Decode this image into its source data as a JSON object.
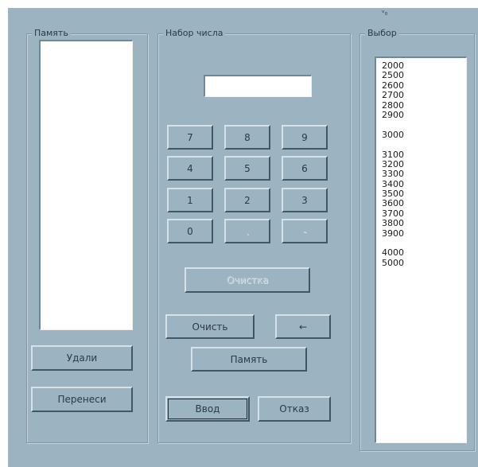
{
  "groups": {
    "memory_title": "Память",
    "input_title": "Набор числа",
    "choice_title": "Выбор"
  },
  "memory": {
    "items": [],
    "delete_label": "Удали",
    "transfer_label": "Перенеси"
  },
  "input": {
    "display_value": "",
    "keypad": [
      "7",
      "8",
      "9",
      "4",
      "5",
      "6",
      "1",
      "2",
      "3",
      "0",
      ".",
      "-"
    ],
    "backspace_label": "Очистка",
    "clear_label": "Очисть",
    "back_arrow": "←",
    "memory_label": "Память",
    "enter_label": "Ввод",
    "cancel_label": "Отказ"
  },
  "choice": {
    "values": [
      "2000",
      "2500",
      "2600",
      "2700",
      "2800",
      "2900",
      "",
      "3000",
      "",
      "3100",
      "3200",
      "3300",
      "3400",
      "3500",
      "3600",
      "3700",
      "3800",
      "3900",
      "",
      "4000",
      "5000"
    ]
  },
  "misc": {
    "tick_glyph": "ᵛ₀"
  }
}
